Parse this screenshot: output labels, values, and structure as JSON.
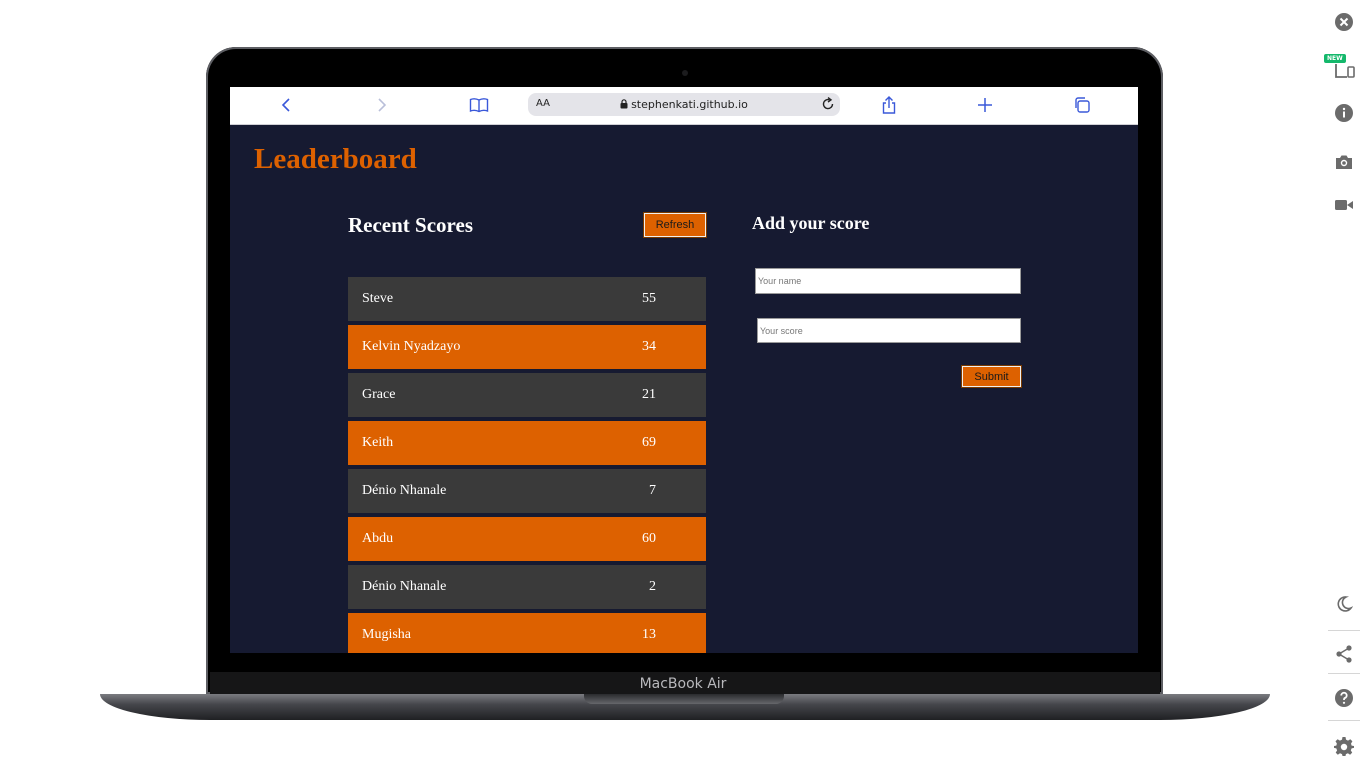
{
  "device": {
    "label": "MacBook Air"
  },
  "browser": {
    "text_size_label": "AA",
    "url": "stephenkati.github.io",
    "icons": [
      "back-icon",
      "forward-icon",
      "bookmarks-icon",
      "lock-icon",
      "reload-icon",
      "share-icon",
      "new-tab-icon",
      "tabs-icon"
    ]
  },
  "app": {
    "title": "Leaderboard",
    "recent_scores": {
      "heading": "Recent Scores",
      "refresh_label": "Refresh",
      "rows": [
        {
          "name": "Steve",
          "score": "55"
        },
        {
          "name": "Kelvin Nyadzayo",
          "score": "34"
        },
        {
          "name": "Grace",
          "score": "21"
        },
        {
          "name": "Keith",
          "score": "69"
        },
        {
          "name": "Dénio Nhanale",
          "score": "7"
        },
        {
          "name": "Abdu",
          "score": "60"
        },
        {
          "name": "Dénio Nhanale",
          "score": "2"
        },
        {
          "name": "Mugisha",
          "score": "13"
        }
      ]
    },
    "add_score": {
      "heading": "Add your score",
      "name_placeholder": "Your name",
      "name_value": "",
      "score_placeholder": "Your score",
      "score_value": "",
      "submit_label": "Submit"
    }
  },
  "sidebar": {
    "badge": "NEW",
    "icons": [
      "close-icon",
      "responsive-devices-icon",
      "info-icon",
      "camera-icon",
      "video-icon",
      "dark-mode-icon",
      "share-icon",
      "help-icon",
      "settings-icon"
    ]
  },
  "colors": {
    "accent": "#dd6100",
    "page_background": "#161a31",
    "row_dark": "#3a3a3a",
    "browser_blue": "#3a58d9"
  }
}
